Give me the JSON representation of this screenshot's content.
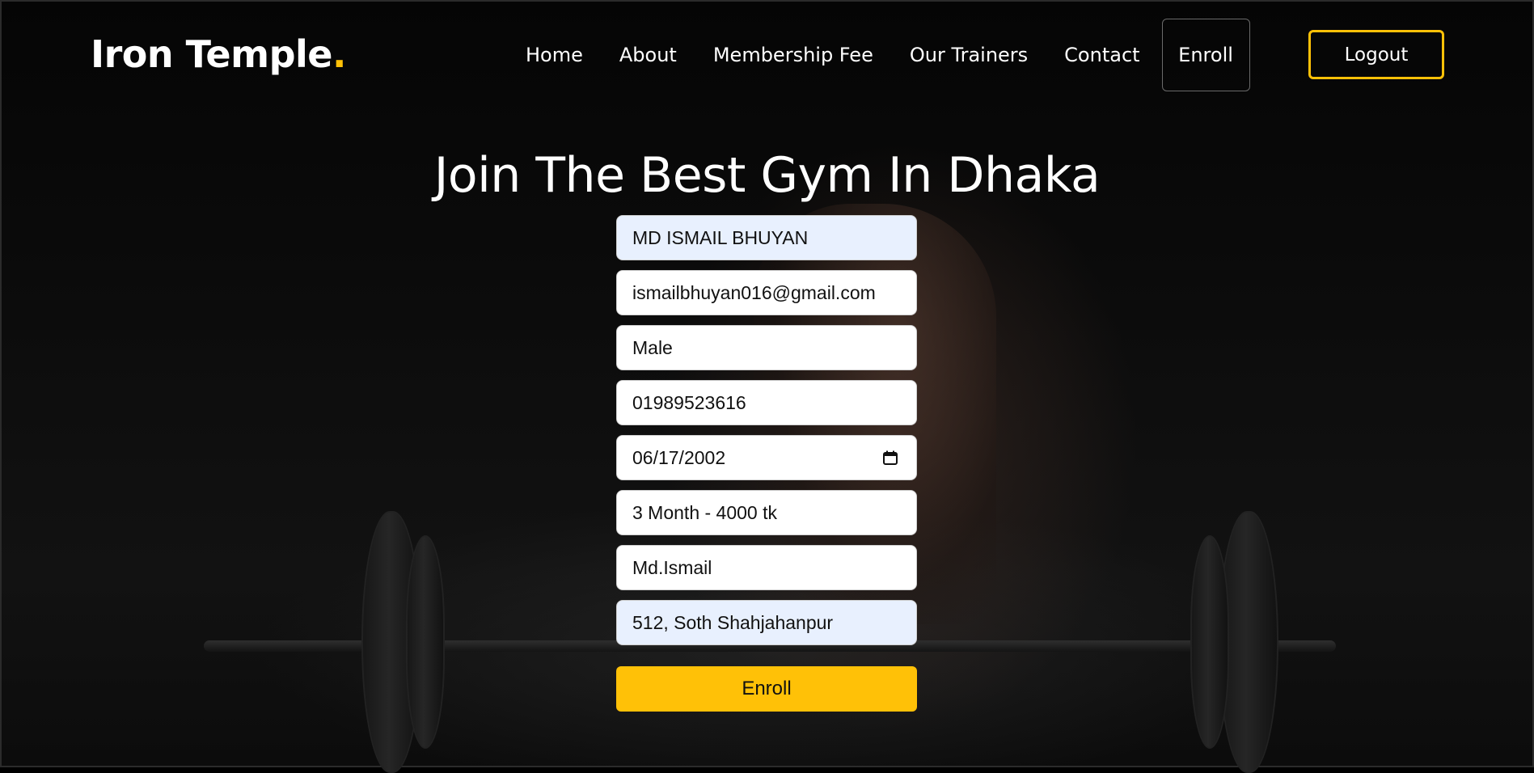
{
  "brand": {
    "name": "Iron Temple",
    "dot": ".",
    "accent_color": "#ffc107"
  },
  "nav": {
    "items": [
      "Home",
      "About",
      "Membership Fee",
      "Our Trainers",
      "Contact"
    ],
    "enroll_label": "Enroll",
    "logout_label": "Logout"
  },
  "hero": {
    "title": "Join The Best Gym In Dhaka"
  },
  "form": {
    "name": "MD ISMAIL BHUYAN",
    "email": "ismailbhuyan016@gmail.com",
    "gender": "Male",
    "phone": "01989523616",
    "dob": "06/17/2002",
    "package": "3 Month - 4000 tk",
    "trainer": "Md.Ismail",
    "address": "512, Soth Shahjahanpur",
    "submit_label": "Enroll"
  }
}
